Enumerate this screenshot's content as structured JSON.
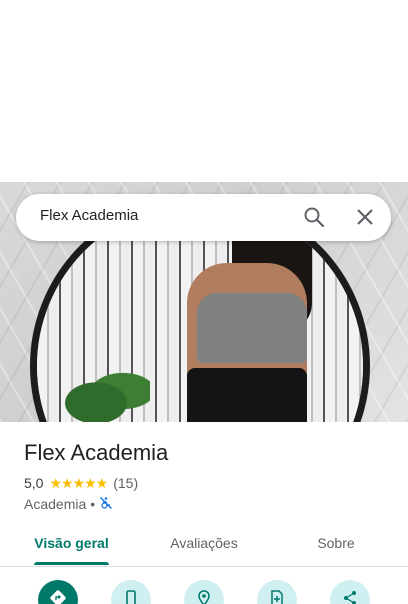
{
  "search": {
    "query": "Flex Academia"
  },
  "place": {
    "name": "Flex Academia",
    "rating": "5,0",
    "stars": "★★★★★",
    "review_count": "(15)",
    "category": "Academia",
    "separator": "•"
  },
  "tabs": [
    {
      "label": "Visão geral"
    },
    {
      "label": "Avaliações"
    },
    {
      "label": "Sobre"
    }
  ],
  "actions": [
    {
      "icon": "directions-icon"
    },
    {
      "icon": "phone-icon"
    },
    {
      "icon": "location-save-icon"
    },
    {
      "icon": "add-document-icon"
    },
    {
      "icon": "share-icon"
    }
  ],
  "colors": {
    "accent": "#00796b",
    "star": "#fbbc04",
    "action_bg": "#cfeff0"
  }
}
